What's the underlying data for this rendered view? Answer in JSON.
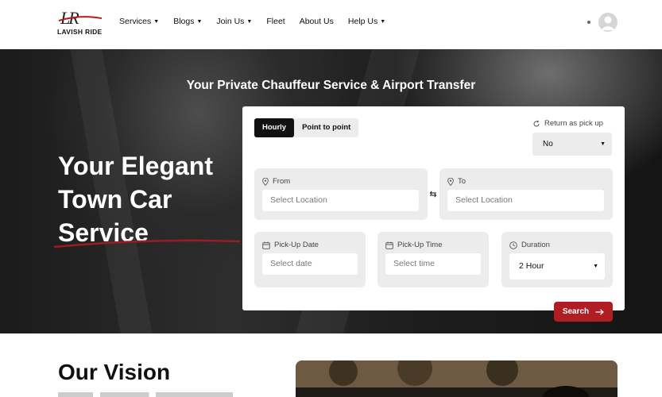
{
  "brand": {
    "logo_mark": "LR",
    "logo_text": "LAVISH RIDE"
  },
  "nav": [
    {
      "label": "Services",
      "caret": true
    },
    {
      "label": "Blogs",
      "caret": true
    },
    {
      "label": "Join Us",
      "caret": true
    },
    {
      "label": "Fleet",
      "caret": false
    },
    {
      "label": "About Us",
      "caret": false
    },
    {
      "label": "Help Us",
      "caret": true
    }
  ],
  "hero": {
    "title": "Your Private Chauffeur Service & Airport Transfer",
    "heading_line1": "Your Elegant",
    "heading_line2": "Town Car",
    "heading_line3": "Service"
  },
  "booking": {
    "tab_hourly": "Hourly",
    "tab_point": "Point to point",
    "return_label": "Return as pick up",
    "return_value": "No",
    "from_label": "From",
    "from_placeholder": "Select Location",
    "to_label": "To",
    "to_placeholder": "Select Location",
    "pickup_date_label": "Pick-Up Date",
    "pickup_date_placeholder": "Select date",
    "pickup_time_label": "Pick-Up Time",
    "pickup_time_placeholder": "Select time",
    "duration_label": "Duration",
    "duration_value": "2 Hour",
    "search_label": "Search"
  },
  "vision": {
    "title": "Our Vision"
  },
  "colors": {
    "accent": "#b01e23",
    "dark": "#111111"
  },
  "icons": [
    "chevron-down-icon",
    "user-avatar-icon",
    "refresh-icon",
    "location-pin-icon",
    "swap-icon",
    "calendar-icon",
    "clock-icon",
    "arrow-right-icon"
  ]
}
